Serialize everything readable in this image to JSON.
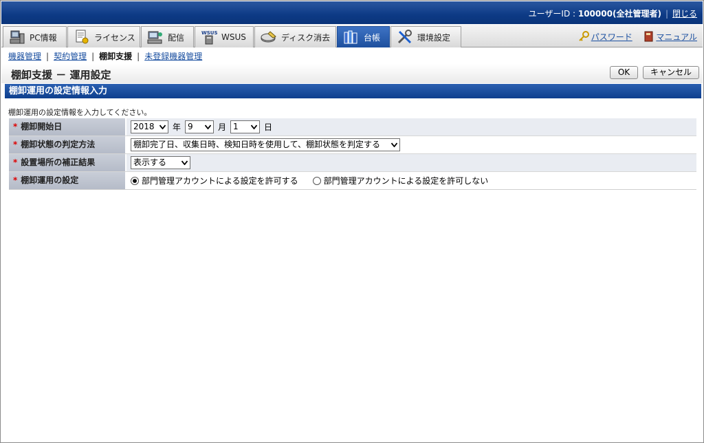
{
  "header": {
    "user_prefix": "ユーザーID : ",
    "user_value": "100000(全社管理者)",
    "close_label": "閉じる"
  },
  "tabs": [
    {
      "label": "PC情報",
      "icon": "pc-icon"
    },
    {
      "label": "ライセンス",
      "icon": "license-icon"
    },
    {
      "label": "配信",
      "icon": "delivery-icon"
    },
    {
      "label": "WSUS",
      "icon": "wsus-icon"
    },
    {
      "label": "ディスク消去",
      "icon": "disk-erase-icon"
    },
    {
      "label": "台帳",
      "icon": "ledger-icon",
      "active": true
    },
    {
      "label": "環境設定",
      "icon": "settings-tools-icon"
    }
  ],
  "links": {
    "password": "パスワード",
    "manual": "マニュアル"
  },
  "subnav": {
    "items": [
      "機器管理",
      "契約管理",
      "棚卸支援",
      "未登録機器管理"
    ]
  },
  "page": {
    "title": "棚卸支援 － 運用設定",
    "ok_label": "OK",
    "cancel_label": "キャンセル",
    "section_title": "棚卸運用の設定情報入力",
    "instruction": "棚卸運用の設定情報を入力してください。"
  },
  "form": {
    "required_mark": "*",
    "rows": [
      {
        "label": "棚卸開始日"
      },
      {
        "label": "棚卸状態の判定方法"
      },
      {
        "label": "設置場所の補正結果"
      },
      {
        "label": "棚卸運用の設定"
      }
    ],
    "start_year": "2018",
    "year_unit": "年",
    "start_month": "9",
    "month_unit": "月",
    "start_day": "1",
    "day_unit": "日",
    "judge_method": "棚卸完了日、収集日時、検知日時を使用して、棚卸状態を判定する",
    "correction": "表示する",
    "radio_allow": "部門管理アカウントによる設定を許可する",
    "radio_deny": "部門管理アカウントによる設定を許可しない",
    "radio_selected": "allow"
  },
  "colors": {
    "header_blue": "#0d3a85",
    "link_blue": "#1a4fa0",
    "required_red": "#dd0000"
  }
}
